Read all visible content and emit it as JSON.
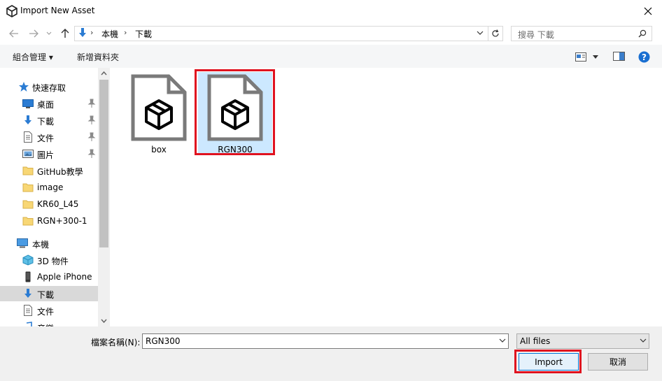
{
  "window": {
    "title": "Import New Asset"
  },
  "nav": {
    "breadcrumb": [
      "本機",
      "下載"
    ],
    "search_placeholder": "搜尋 下載"
  },
  "toolbar": {
    "organize_label": "組合管理 ▾",
    "new_folder_label": "新增資料夾"
  },
  "sidebar": {
    "quick_access_label": "快速存取",
    "quick_items": [
      {
        "label": "桌面",
        "icon": "desktop-icon",
        "pinned": true
      },
      {
        "label": "下載",
        "icon": "download-arrow-icon",
        "pinned": true
      },
      {
        "label": "文件",
        "icon": "document-icon",
        "pinned": true
      },
      {
        "label": "圖片",
        "icon": "pictures-icon",
        "pinned": true
      },
      {
        "label": "GitHub教學",
        "icon": "folder-icon",
        "pinned": false
      },
      {
        "label": "image",
        "icon": "folder-icon",
        "pinned": false
      },
      {
        "label": "KR60_L45",
        "icon": "folder-icon",
        "pinned": false
      },
      {
        "label": "RGN+300-1",
        "icon": "folder-icon",
        "pinned": false
      }
    ],
    "this_pc_label": "本機",
    "pc_items": [
      {
        "label": "3D 物件",
        "icon": "3d-objects-icon"
      },
      {
        "label": "Apple iPhone",
        "icon": "phone-icon"
      },
      {
        "label": "下載",
        "icon": "download-arrow-icon"
      },
      {
        "label": "文件",
        "icon": "document-icon"
      },
      {
        "label": "音樂",
        "icon": "music-icon"
      }
    ]
  },
  "files": [
    {
      "name": "box",
      "icon": "unity-asset-file-icon",
      "selected": false
    },
    {
      "name": "RGN300",
      "icon": "unity-asset-file-icon",
      "selected": true
    }
  ],
  "bottom": {
    "filename_label": "檔案名稱(N):",
    "filename_value": "RGN300",
    "filter_value": "All files",
    "import_label": "Import",
    "cancel_label": "取消"
  },
  "colors": {
    "highlight_red": "#e0121f",
    "selection_blue": "#cce8ff",
    "help_blue": "#1a6fd1"
  }
}
